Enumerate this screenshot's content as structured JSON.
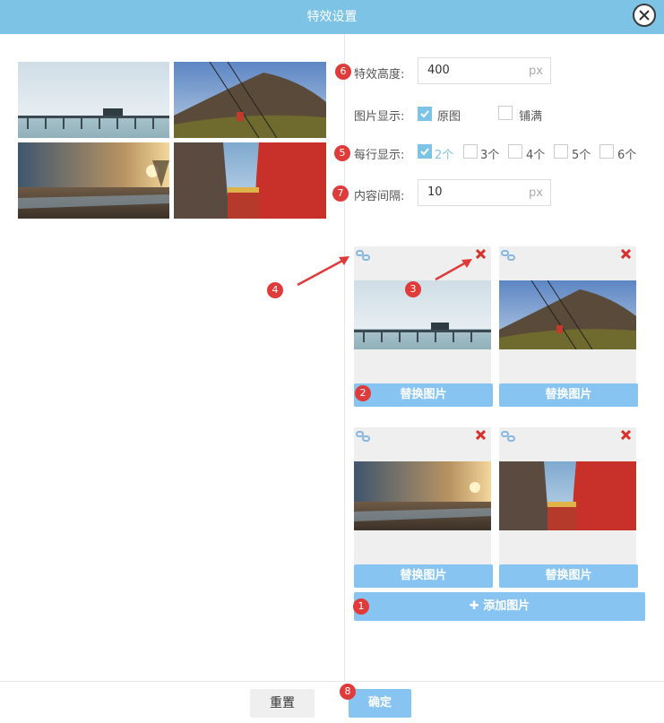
{
  "dialog": {
    "title": "特效设置"
  },
  "form": {
    "height_label": "特效高度:",
    "height_value": "400",
    "height_unit": "px",
    "display_label": "图片显示:",
    "display_options": [
      {
        "label": "原图",
        "checked": true
      },
      {
        "label": "铺满",
        "checked": false
      }
    ],
    "per_row_label": "每行显示:",
    "per_row_options": [
      {
        "label": "2个",
        "checked": true
      },
      {
        "label": "3个",
        "checked": false
      },
      {
        "label": "4个",
        "checked": false
      },
      {
        "label": "5个",
        "checked": false
      },
      {
        "label": "6个",
        "checked": false
      }
    ],
    "spacing_label": "内容间隔:",
    "spacing_value": "10",
    "spacing_unit": "px"
  },
  "cards": [
    {
      "replace_label": "替换图片",
      "image": "bridge-lake"
    },
    {
      "replace_label": "替换图片",
      "image": "cable-car-mountain"
    },
    {
      "replace_label": "替换图片",
      "image": "sunset-shore"
    },
    {
      "replace_label": "替换图片",
      "image": "red-wall-rock"
    }
  ],
  "add_image_label": "添加图片",
  "footer": {
    "reset_label": "重置",
    "ok_label": "确定"
  },
  "badges": [
    "1",
    "2",
    "3",
    "4",
    "5",
    "6",
    "7",
    "8"
  ],
  "colors": {
    "accent": "#7cc3e6",
    "button": "#88c4f2",
    "badge": "#e03b3b",
    "delete": "#d9302c"
  }
}
